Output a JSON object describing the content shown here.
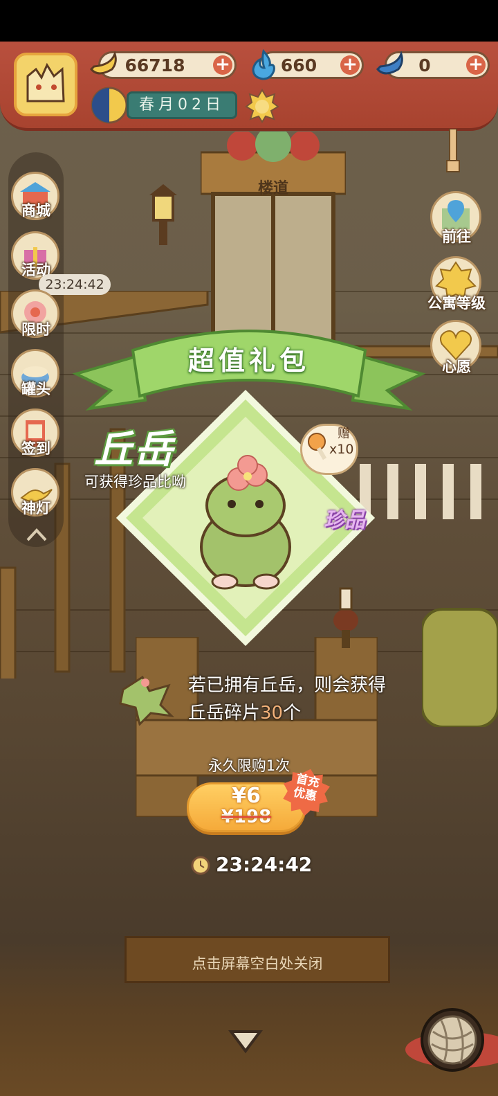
{
  "resources": {
    "banana": "66718",
    "fire": "660",
    "blue_banana": "0"
  },
  "date_text": "春月02日",
  "left_menu": {
    "shop": "商城",
    "events": "活动",
    "limited": "限时",
    "limited_timer": "23:24:42",
    "cans": "罐头",
    "checkin": "签到",
    "lamp": "神灯"
  },
  "right_menu": {
    "go_to": "前往",
    "apartment_level": "公寓等级",
    "wish": "心愿"
  },
  "scene": {
    "sign": "楼道"
  },
  "popup": {
    "title": "超值礼包",
    "character_name": "丘岳",
    "character_sub": "可获得珍品比呦",
    "rarity": "珍品",
    "gift_label": "赠",
    "gift_count": "x10",
    "desc_line1": "若已拥有丘岳，则会获得",
    "desc_line2_prefix": "丘岳碎片",
    "desc_line2_number": "30",
    "desc_line2_suffix": "个",
    "limit_text": "永久限购1次",
    "price": "¥6",
    "original_price": "¥198",
    "badge_line1": "首充",
    "badge_line2": "优惠",
    "countdown": "23:24:42"
  },
  "close_hint": "点击屏幕空白处关闭",
  "colors": {
    "ribbon_green": "#8fcd5a",
    "popup_green": "#b9e07f",
    "price_orange": "#f5aa3a",
    "badge_red": "#ef6a45",
    "topbar_red": "#b24a37"
  },
  "icons": [
    "banana-icon",
    "fire-icon",
    "blue-banana-icon",
    "plus-icon",
    "sun-icon",
    "clock-icon",
    "chevron-up-icon",
    "down-arrow-icon",
    "yarn-ball-icon"
  ]
}
